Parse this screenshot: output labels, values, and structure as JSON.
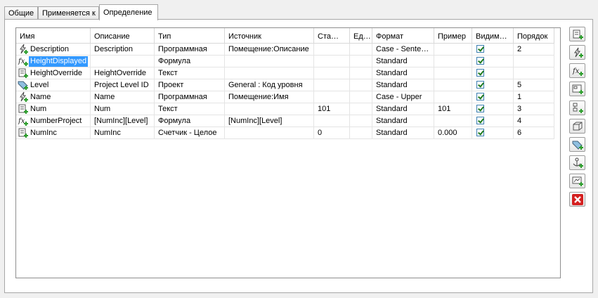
{
  "tabs": [
    {
      "label": "Общие"
    },
    {
      "label": "Применяется к"
    },
    {
      "label": "Определение"
    }
  ],
  "table": {
    "columns": [
      "Имя",
      "Описание",
      "Тип",
      "Источник",
      "Ста…",
      "Ед…",
      "Формат",
      "Пример",
      "Видим…",
      "Порядок"
    ],
    "rows": [
      {
        "icon": "automatic-property-icon",
        "name": "Description",
        "desc": "Description",
        "type": "Программная",
        "source": "Помещение:Описание",
        "start": "",
        "inc": "",
        "format": "Case - Sente…",
        "example": "",
        "visible": true,
        "order": "2"
      },
      {
        "icon": "formula-property-icon",
        "name": "HeightDisplayed",
        "desc": "",
        "type": "Формула",
        "source": "",
        "start": "",
        "inc": "",
        "format": "Standard",
        "example": "",
        "visible": true,
        "order": ""
      },
      {
        "icon": "text-property-icon",
        "name": "HeightOverride",
        "desc": "HeightOverride",
        "type": "Текст",
        "source": "",
        "start": "",
        "inc": "",
        "format": "Standard",
        "example": "",
        "visible": true,
        "order": ""
      },
      {
        "icon": "project-property-icon",
        "name": "Level",
        "desc": "Project Level ID",
        "type": "Проект",
        "source": "General : Код уровня",
        "start": "",
        "inc": "",
        "format": "Standard",
        "example": "",
        "visible": true,
        "order": "5"
      },
      {
        "icon": "automatic-property-icon",
        "name": "Name",
        "desc": "Name",
        "type": "Программная",
        "source": "Помещение:Имя",
        "start": "",
        "inc": "",
        "format": "Case - Upper",
        "example": "",
        "visible": true,
        "order": "1"
      },
      {
        "icon": "text-property-icon",
        "name": "Num",
        "desc": "Num",
        "type": "Текст",
        "source": "",
        "start": "101",
        "inc": "",
        "format": "Standard",
        "example": "101",
        "visible": true,
        "order": "3"
      },
      {
        "icon": "formula-property-icon",
        "name": "NumberProject",
        "desc": "[NumInc][Level]",
        "type": "Формула",
        "source": "[NumInc][Level]",
        "start": "",
        "inc": "",
        "format": "Standard",
        "example": "",
        "visible": true,
        "order": "4"
      },
      {
        "icon": "counter-property-icon",
        "name": "NumInc",
        "desc": "NumInc",
        "type": "Счетчик - Целое",
        "source": "",
        "start": "0",
        "inc": "",
        "format": "Standard",
        "example": "0.000",
        "visible": true,
        "order": "6"
      }
    ]
  },
  "toolbar": [
    {
      "icon": "add-manual-property-icon"
    },
    {
      "icon": "add-automatic-property-icon"
    },
    {
      "icon": "add-formula-property-icon"
    },
    {
      "icon": "add-location-property-icon"
    },
    {
      "icon": "add-classification-property-icon"
    },
    {
      "icon": "add-material-property-icon"
    },
    {
      "icon": "add-project-property-icon"
    },
    {
      "icon": "add-anchor-property-icon"
    },
    {
      "icon": "add-graphical-property-icon"
    },
    {
      "icon": "delete-property-icon"
    }
  ],
  "colors": {
    "selection": "#3399ff",
    "icon_green": "#2a9d2a",
    "delete_red": "#d42020",
    "check_border": "#3c7fb1"
  }
}
